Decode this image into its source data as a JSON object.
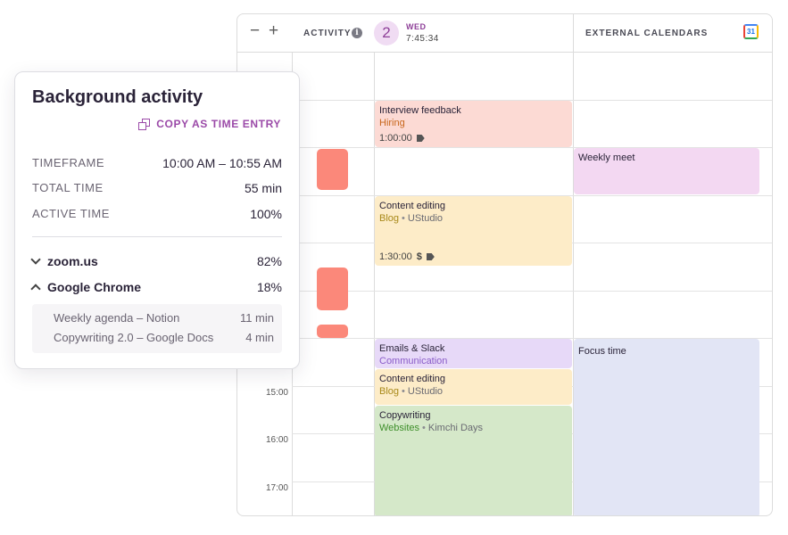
{
  "header": {
    "zoom_out": "−",
    "zoom_in": "+",
    "activity_label": "ACTIVITY",
    "day_number": "2",
    "day_name": "WED",
    "current_time": "7:45:34",
    "external_label": "EXTERNAL CALENDARS",
    "gcal_badge": "31"
  },
  "time_labels": [
    "15:00",
    "16:00",
    "17:00"
  ],
  "events": [
    {
      "title": "Interview feedback",
      "project": "Hiring",
      "project_color": "#c8661b",
      "duration": "1:00:00",
      "bg": "#fcdad4"
    },
    {
      "title": "Content editing",
      "project": "Blog",
      "project_color": "#a8891a",
      "client": "UStudio",
      "duration": "1:30:00",
      "bg": "#fdecc8"
    },
    {
      "title": "Emails & Slack",
      "project": "Communication",
      "project_color": "#8a5cc8",
      "bg": "#e7d9f8"
    },
    {
      "title": "Content editing",
      "project": "Blog",
      "project_color": "#a8891a",
      "client": "UStudio",
      "bg": "#fdecc8"
    },
    {
      "title": "Copywriting",
      "project": "Websites",
      "project_color": "#3e8f2a",
      "client": "Kimchi Days",
      "bg": "#d5e8c9"
    }
  ],
  "external_events": [
    {
      "title": "Weekly meet",
      "bg": "#f3d8f2"
    },
    {
      "title": "Focus time",
      "bg": "#e2e5f5"
    }
  ],
  "popup": {
    "title": "Background activity",
    "copy_label": "COPY AS TIME ENTRY",
    "stats": [
      {
        "label": "TIMEFRAME",
        "value": "10:00 AM – 10:55 AM"
      },
      {
        "label": "TOTAL TIME",
        "value": "55 min"
      },
      {
        "label": "ACTIVE TIME",
        "value": "100%"
      }
    ],
    "apps": [
      {
        "name": "zoom.us",
        "percent": "82%",
        "expanded": false
      },
      {
        "name": "Google Chrome",
        "percent": "18%",
        "expanded": true
      }
    ],
    "sub_items": [
      {
        "name": "Weekly agenda – Notion",
        "duration": "11 min"
      },
      {
        "name": "Copywriting 2.0 – Google Docs",
        "duration": "4 min"
      }
    ]
  },
  "colors": {
    "accent": "#9b4aa8",
    "activity_block": "#fb887a"
  }
}
